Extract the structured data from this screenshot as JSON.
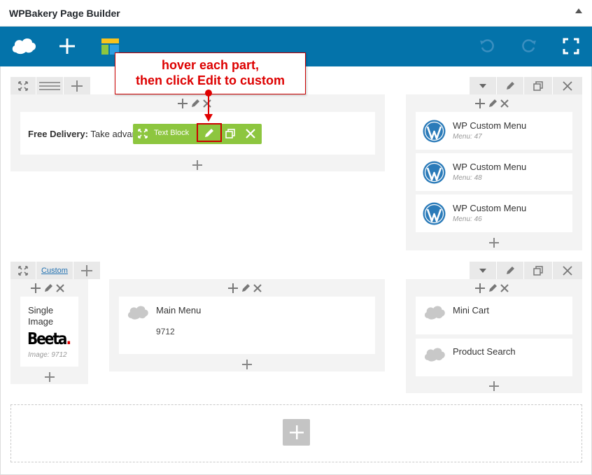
{
  "header": {
    "title": "WPBakery Page Builder"
  },
  "callout": {
    "line1": "hover each part,",
    "line2": "then click Edit to custom"
  },
  "text_block": {
    "label_bold": "Free Delivery:",
    "label_rest": " Take advan",
    "toolbar_label": "Text Block"
  },
  "right_column_top": {
    "items": [
      {
        "title": "WP Custom Menu",
        "sub": "Menu: 47"
      },
      {
        "title": "WP Custom Menu",
        "sub": "Menu: 48"
      },
      {
        "title": "WP Custom Menu",
        "sub": "Menu: 46"
      }
    ]
  },
  "row2": {
    "tab_label": "Custom",
    "single_image": {
      "title": "Single Image",
      "logo_text": "Beeta",
      "sub": "Image: 9712"
    },
    "main_menu": {
      "title": "Main Menu",
      "value": "9712"
    },
    "mini_cart": {
      "title": "Mini Cart"
    },
    "product_search": {
      "title": "Product Search"
    }
  },
  "colors": {
    "toolbar": "#0473aa",
    "accent_green": "#8dc63f",
    "callout_red": "#cc0000"
  }
}
